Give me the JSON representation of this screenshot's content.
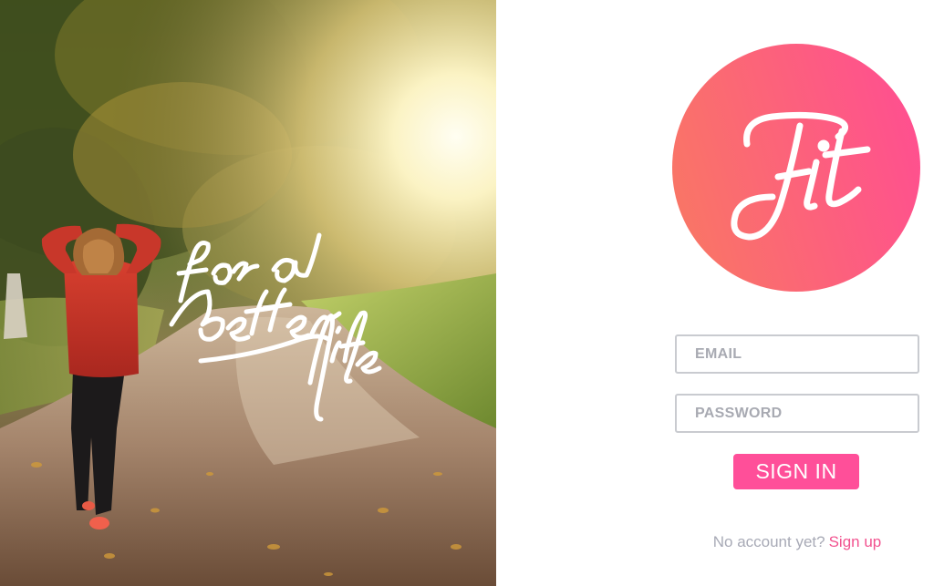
{
  "hero": {
    "tagline_words": [
      "for a",
      "better",
      "life"
    ]
  },
  "logo": {
    "text": "Fit",
    "gradient_start": "#f97566",
    "gradient_end": "#ff4f90"
  },
  "form": {
    "email_placeholder": "EMAIL",
    "password_placeholder": "PASSWORD",
    "signin_label": "SIGN IN",
    "no_account_text": "No account yet?",
    "signup_link": "Sign up"
  },
  "colors": {
    "accent": "#ff4f99",
    "link": "#f2528f",
    "field_border": "#c9cbd0",
    "muted_text": "#a8aab6"
  }
}
